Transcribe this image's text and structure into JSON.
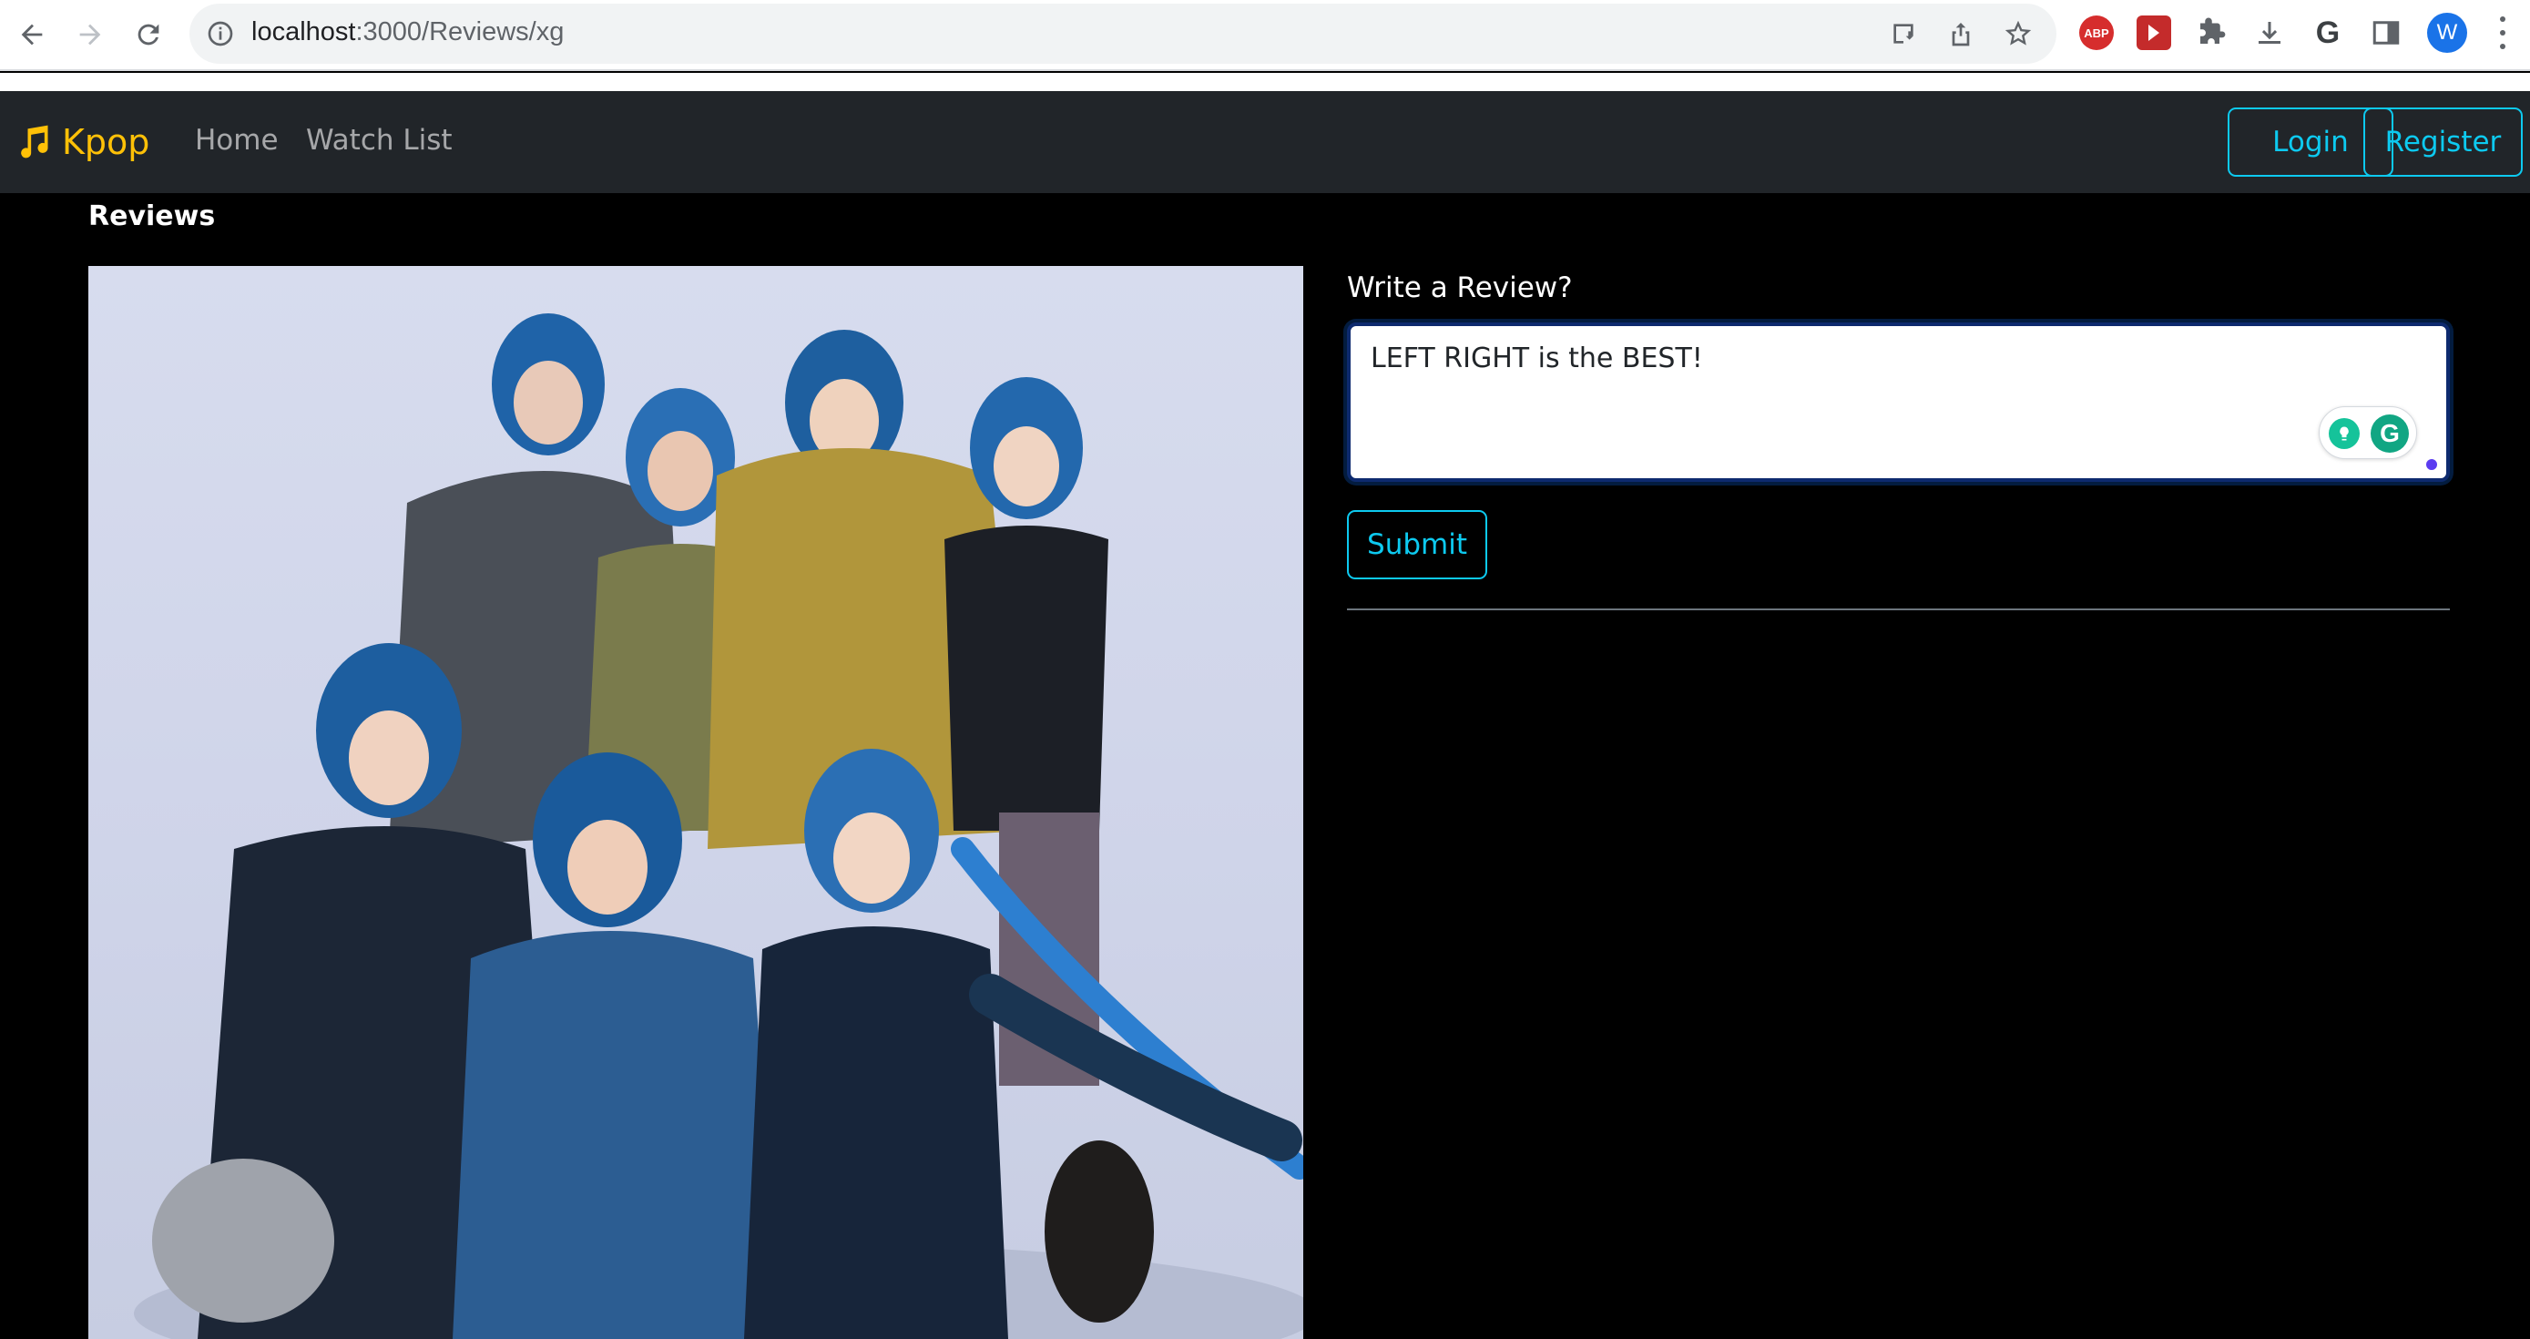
{
  "browser": {
    "url_host": "localhost",
    "url_path": ":3000/Reviews/xg",
    "profile_initial": "W",
    "icons": [
      "back-arrow-icon",
      "forward-arrow-icon",
      "reload-icon",
      "site-info-icon",
      "install-app-icon",
      "share-icon",
      "bookmark-star-icon",
      "adblock-plus-icon",
      "video-extension-icon",
      "puzzle-extensions-icon",
      "download-icon",
      "google-extension-icon",
      "side-panel-icon",
      "kebab-menu-icon"
    ],
    "abp_label": "ABP",
    "g_ext_label": "G"
  },
  "navbar": {
    "brand": "Kpop",
    "links": [
      "Home",
      "Watch List"
    ],
    "login": "Login",
    "register": "Register",
    "colors": {
      "background": "#212529",
      "brand": "#ffc107",
      "accent": "#0dcaf0"
    }
  },
  "main": {
    "heading": "Reviews",
    "form_label": "Write a Review?",
    "review_value": "LEFT RIGHT is the BEST!",
    "submit_label": "Submit",
    "grammarly_label": "G"
  }
}
